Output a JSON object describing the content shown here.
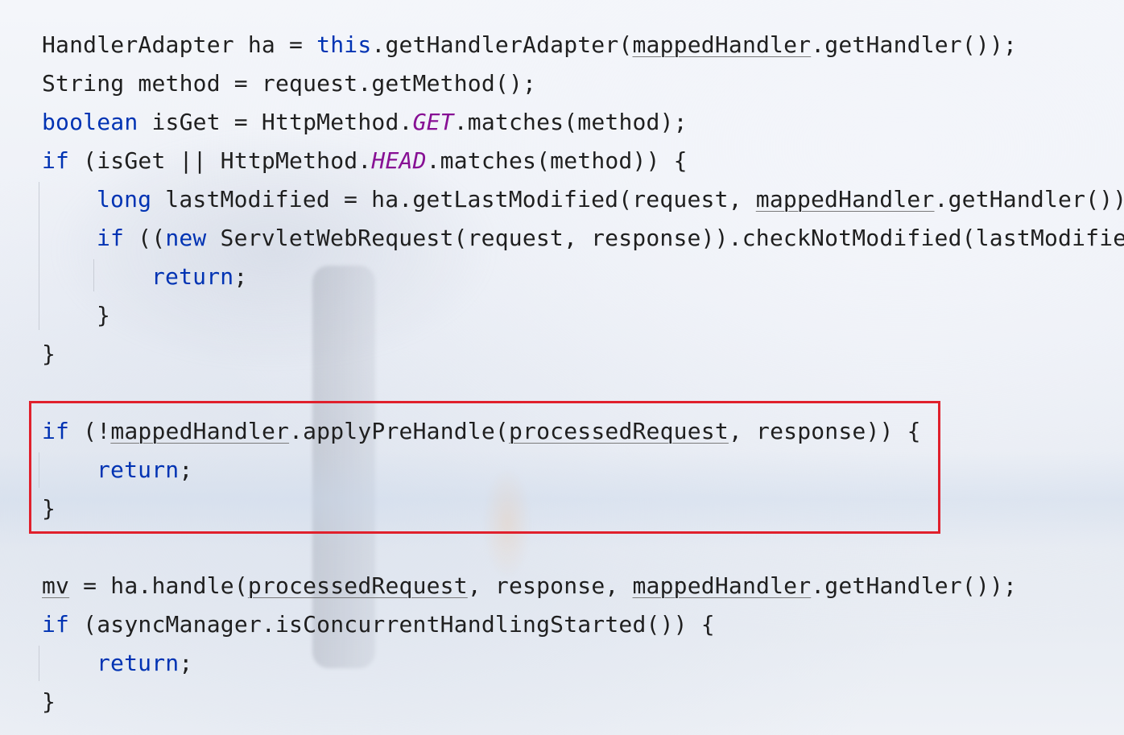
{
  "code": {
    "lines": [
      {
        "t1": "HandlerAdapter ha = ",
        "kw1": "this",
        "t2": ".getHandlerAdapter(",
        "u1": "mappedHandler",
        "t3": ".getHandler());"
      },
      {
        "t1": "String method = request.getMethod();"
      },
      {
        "kw1": "boolean",
        "t1": " isGet = HttpMethod.",
        "st1": "GET",
        "t2": ".matches(method);"
      },
      {
        "kw1": "if",
        "t1": " (isGet || HttpMethod.",
        "st1": "HEAD",
        "t2": ".matches(method)) {"
      },
      {
        "kw1": "long",
        "t1": " lastModified = ha.getLastModified(request, ",
        "u1": "mappedHandler",
        "t2": ".getHandler())"
      },
      {
        "kw1": "if",
        "t1": " ((",
        "kw2": "new",
        "t2": " ServletWebRequest(request, response)).checkNotModified(lastModifie"
      },
      {
        "kw1": "return",
        "t1": ";"
      },
      {
        "t1": "}"
      },
      {
        "t1": "}"
      },
      {
        "kw1": "if",
        "t1": " (!",
        "u1": "mappedHandler",
        "t2": ".applyPreHandle(",
        "u2": "processedRequest",
        "t3": ", response)) {"
      },
      {
        "kw1": "return",
        "t1": ";"
      },
      {
        "t1": "}"
      },
      {
        "u1": "mv",
        "t1": " = ha.handle(",
        "u2": "processedRequest",
        "t2": ", response, ",
        "u3": "mappedHandler",
        "t3": ".getHandler());"
      },
      {
        "kw1": "if",
        "t1": " (asyncManager.isConcurrentHandlingStarted()) {"
      },
      {
        "kw1": "return",
        "t1": ";"
      },
      {
        "t1": "}"
      }
    ]
  },
  "highlight": {
    "color": "#e0202c"
  },
  "colors": {
    "keyword": "#0033b3",
    "static_field": "#871094",
    "text": "#1f1f1f"
  }
}
